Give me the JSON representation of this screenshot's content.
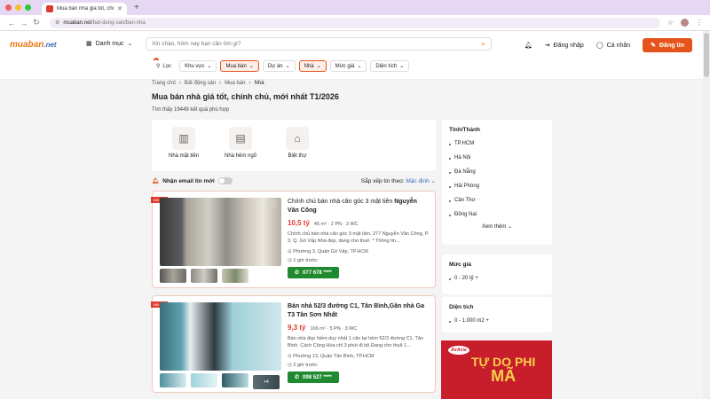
{
  "browser": {
    "tab_title": "Mua bán nhà giá tốt, chính c...",
    "url_domain": "muaban.net",
    "url_path": "/bat-dong-san/ban-nha"
  },
  "header": {
    "logo_main": "muaban",
    "logo_suffix": ".net",
    "category_label": "Danh mục",
    "search_placeholder": "Xin chào, hôm nay bạn cần tìm gì?",
    "login_label": "Đăng nhập",
    "profile_label": "Cá nhân",
    "post_label": "Đăng tin"
  },
  "filters": {
    "badge": "1",
    "items": [
      "Lọc",
      "Khu vực",
      "Mua bán",
      "Dự án",
      "Nhà",
      "Mức giá",
      "Diện tích"
    ]
  },
  "breadcrumb": [
    "Trang chủ",
    "Bất động sản",
    "Mua bán",
    "Nhà"
  ],
  "page_title": "Mua bán nhà giá tốt, chính chủ, mới nhất T1/2026",
  "result_count": "Tìm thấy 19449 kết quả phù hợp",
  "categories": [
    "Nhà mặt tiền",
    "Nhà hẻm ngõ",
    "Biệt thự"
  ],
  "sort": {
    "email_label": "Nhận email tin mới",
    "sort_label": "Sắp xếp tin theo:",
    "sort_value": "Mặc định"
  },
  "listings": [
    {
      "hot": "Nổi bật",
      "title_light": "Chính chủ bán nhà căn góc 3 mặt tiền",
      "title_bold": "Nguyễn Văn Công",
      "price": "10,5 tỷ",
      "specs": "45 m² · 2 PN · 3 WC",
      "desc": "Chính chủ bán nhà căn góc 3 mặt tiền, 277 Nguyễn Văn Công, P. 3, Q. Gò Vấp Nhà đẹp, đang cho thuê. * Thông tin...",
      "location": "Phường 3, Quận Gò Vấp, TP.HCM",
      "time": "1 giờ trước",
      "phone": "077 678 ****"
    },
    {
      "hot": "Nổi bật",
      "title_light": "",
      "title_bold": "Bán nhà 52/3 đường C1, Tân Bình,Gần nhà Ga T3 Tân Sơn Nhất",
      "price": "9,3 tỷ",
      "specs": "106 m² · 5 PN · 3 WC",
      "desc": "Bán nhà đẹp hiếm duy nhất 1 căn tại hẻm 52/3 đường C1, Tân Bình. Cách Cộng Hòa chỉ 3 phút đi bộ Đang cho thuê 1...",
      "location": "Phường 13, Quận Tân Bình, TP.HCM",
      "time": "2 giờ trước",
      "phone": "098 527 ****",
      "more_photos": "+4"
    }
  ],
  "sidebar": {
    "city_title": "Tỉnh/Thành",
    "cities": [
      "TP.HCM",
      "Hà Nội",
      "Đà Nẵng",
      "Hải Phòng",
      "Cần Thơ",
      "Đồng Nai"
    ],
    "see_more": "Xem thêm",
    "price_title": "Mức giá",
    "price_range": "0 - 20 tỷ +",
    "area_title": "Diện tích",
    "area_range": "0 - 1.000 m2 +"
  },
  "ad": {
    "brand": "AirAsia",
    "line1": "TỰ DO PHI",
    "line2": "MÃ"
  },
  "colors": {
    "accent": "#e5541b",
    "price": "#e03b2b",
    "phone": "#1f8a2f",
    "link": "#3a6db6"
  }
}
